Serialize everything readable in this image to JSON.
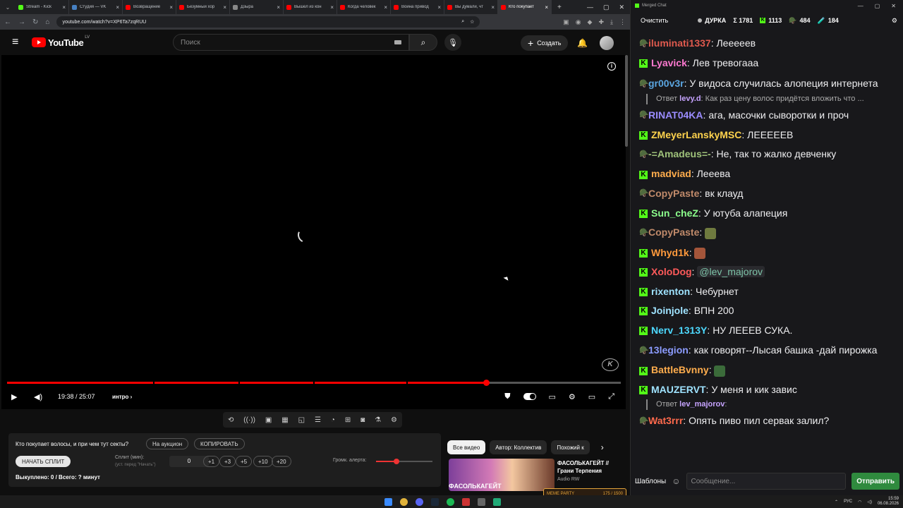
{
  "browser": {
    "tabs": [
      {
        "label": "Stream - Kick",
        "color": "#53fc18"
      },
      {
        "label": "Студия — VK",
        "color": "#4680c2"
      },
      {
        "label": "Возвращение",
        "color": "#ff0000"
      },
      {
        "label": "Безумный хор",
        "color": "#ff0000"
      },
      {
        "label": "Дзыра",
        "color": "#888888"
      },
      {
        "label": "Вышел из кон",
        "color": "#ff0000"
      },
      {
        "label": "Когда человек",
        "color": "#ff0000"
      },
      {
        "label": "Война привод",
        "color": "#ff0000"
      },
      {
        "label": "Вы думали, чт",
        "color": "#ff0000"
      },
      {
        "label": "Кто покупает",
        "color": "#ff0000",
        "active": true
      }
    ],
    "url": "youtube.com/watch?v=XP6Ta7zqRUU",
    "new_tab": "+"
  },
  "youtube": {
    "logo": "YouTube",
    "region": "LV",
    "search_placeholder": "Поиск",
    "create_label": "Создать"
  },
  "player": {
    "current_time": "19:38",
    "duration": "25:07",
    "time_display": "19:38 / 25:07",
    "chapter": "интро",
    "progress_fraction": 0.781,
    "watermark": "K"
  },
  "panel": {
    "question": "Кто покупает волосы, и при чем тут секты?",
    "auction_label": "На аукцион",
    "copy_label": "КОПИРОВАТЬ",
    "start_split_label": "НАЧАТЬ СПЛИТ",
    "split_label": "Сплит (мин):",
    "split_hint": "(уст. перед \"Начать\")",
    "split_value": "0",
    "increments": [
      "+1",
      "+3",
      "+5",
      "+10",
      "+20"
    ],
    "volume_label": "Громк. алерта:",
    "volume_fraction": 0.36,
    "bought_label": "Выкуплено: 0 / Всего: ? минут"
  },
  "recommendations": {
    "chips": [
      "Все видео",
      "Автор: Коллектив",
      "Похожий к"
    ],
    "video_title": "ФАСОЛЬКАГЕЙТ // Грани Терпения",
    "thumb_text": "ФАСОЛЬКАГЕЙТ",
    "channel": "Audio RW",
    "meme_label": "MEME PARTY",
    "meme_count": "175 / 1500"
  },
  "chat": {
    "window_title": "Merged Chat",
    "clear_label": "Очистить",
    "channel": "ДУРКА",
    "total": "Σ 1781",
    "kick_count": "1113",
    "twitch_count": "484",
    "other_count": "184",
    "messages": [
      {
        "platform": "t",
        "user": "iluminati1337",
        "color": "#e05a4e",
        "text": "Лееееев"
      },
      {
        "platform": "k",
        "user": "Lyavick",
        "color": "#ff7ad1",
        "text": "Лев тревогааа"
      },
      {
        "platform": "t",
        "user": "gr00v3r",
        "color": "#5aa5e0",
        "text": "У видоса случилась алопеция интернета",
        "wrap": true
      },
      {
        "reply": true,
        "reply_user": "levy.d",
        "reply_text": "Как раз цену волос придётся вложить что ..."
      },
      {
        "platform": "t",
        "user": "RINAT04KA",
        "color": "#9b8cff",
        "text": "ага, масочки сыворотки и проч"
      },
      {
        "platform": "k",
        "user": "ZMeyerLanskyMSC",
        "color": "#ffd34d",
        "text": "ЛЕЕЕЕЕВ"
      },
      {
        "platform": "t",
        "user": "-=Amadeus=-",
        "color": "#9fc27a",
        "text": "Не, так то жалко девченку"
      },
      {
        "platform": "k",
        "user": "madviad",
        "color": "#ffad4d",
        "text": "Лееева"
      },
      {
        "platform": "t",
        "user": "CopyPaste",
        "color": "#c08a6a",
        "text": "вк клауд"
      },
      {
        "platform": "k",
        "user": "Sun_cheZ",
        "color": "#8cff8c",
        "text": "У ютуба алапеция"
      },
      {
        "platform": "t",
        "user": "CopyPaste",
        "color": "#c08a6a",
        "text": "",
        "emote": "#6f7a3f"
      },
      {
        "platform": "k",
        "user": "Whyd1k",
        "color": "#ff9a3c",
        "text": "",
        "emote": "#a4553a"
      },
      {
        "platform": "k",
        "user": "XoloDog",
        "color": "#ff5a5a",
        "text": "",
        "mention": "@lev_majorov"
      },
      {
        "platform": "k",
        "user": "rixenton",
        "color": "#9fe3ff",
        "text": "Чебурнет"
      },
      {
        "platform": "k",
        "user": "Joinjole",
        "color": "#9fe3ff",
        "text": "ВПН 200"
      },
      {
        "platform": "k",
        "user": "Nerv_1313Y",
        "color": "#4dd9ff",
        "text": "НУ ЛЕЕЕВ СУКА."
      },
      {
        "platform": "t",
        "user": "13legion",
        "color": "#8c9cff",
        "text": "как  говорят--Лысая башка -дай пирожка",
        "wrap": true
      },
      {
        "platform": "k",
        "user": "BattleBvnny",
        "color": "#ffad4d",
        "text": "",
        "emote": "#3b6b3a"
      },
      {
        "platform": "k",
        "user": "MAUZERVT",
        "color": "#9fe3ff",
        "text": "У меня и кик завис"
      },
      {
        "reply": true,
        "reply_user": "lev_majorov",
        "reply_text": ""
      },
      {
        "platform": "t",
        "user": "Wat3rrr",
        "color": "#ff6a4d",
        "text": "Опять пиво пил сервак залил?"
      }
    ],
    "templates_label": "Шаблоны",
    "message_placeholder": "Сообщение...",
    "send_label": "Отправить",
    "reply_prefix": "Ответ"
  },
  "taskbar": {
    "lang": "РУС",
    "time": "15:59",
    "date": "06.08.2026"
  }
}
